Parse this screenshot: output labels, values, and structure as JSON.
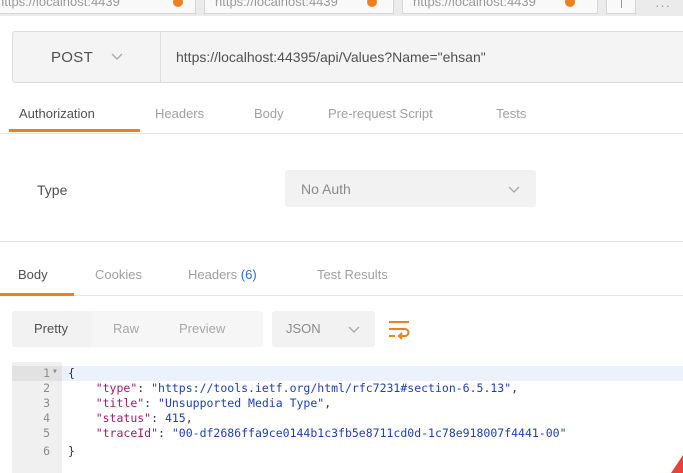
{
  "browser_tabs": [
    {
      "label": "https://localhost:4439"
    },
    {
      "label": "https://localhost:4439"
    },
    {
      "label": "https://localhost:4439"
    }
  ],
  "request": {
    "method": "POST",
    "url": "https://localhost:44395/api/Values?Name=\"ehsan\""
  },
  "request_tabs": [
    "Authorization",
    "Headers",
    "Body",
    "Pre-request Script",
    "Tests"
  ],
  "auth": {
    "type_label": "Type",
    "type_value": "No Auth"
  },
  "response_tabs": {
    "body": "Body",
    "cookies": "Cookies",
    "headers": "Headers",
    "headers_count": "(6)",
    "test_results": "Test Results"
  },
  "format": {
    "pretty": "Pretty",
    "raw": "Raw",
    "preview": "Preview",
    "language": "JSON"
  },
  "code_lines": [
    {
      "n": "1",
      "parts": [
        [
          "pun",
          "{"
        ]
      ]
    },
    {
      "n": "2",
      "parts": [
        [
          "pun",
          "    "
        ],
        [
          "key",
          "\"type\""
        ],
        [
          "pun",
          ": "
        ],
        [
          "str",
          "\"https://tools.ietf.org/html/rfc7231#section-6.5.13\""
        ],
        [
          "pun",
          ","
        ]
      ]
    },
    {
      "n": "3",
      "parts": [
        [
          "pun",
          "    "
        ],
        [
          "key",
          "\"title\""
        ],
        [
          "pun",
          ": "
        ],
        [
          "str",
          "\"Unsupported Media Type\""
        ],
        [
          "pun",
          ","
        ]
      ]
    },
    {
      "n": "4",
      "parts": [
        [
          "pun",
          "    "
        ],
        [
          "key",
          "\"status\""
        ],
        [
          "pun",
          ": "
        ],
        [
          "num",
          "415"
        ],
        [
          "pun",
          ","
        ]
      ]
    },
    {
      "n": "5",
      "parts": [
        [
          "pun",
          "    "
        ],
        [
          "key",
          "\"traceId\""
        ],
        [
          "pun",
          ": "
        ],
        [
          "str",
          "\"00-df2686ffa9ce0144b1c3fb5e8711cd0d-1c78e918007f4441-00\""
        ]
      ]
    },
    {
      "n": "6",
      "parts": [
        [
          "pun",
          "}"
        ]
      ]
    }
  ],
  "colors": {
    "accent": "#f0801f",
    "link_count": "#2a6acf"
  }
}
